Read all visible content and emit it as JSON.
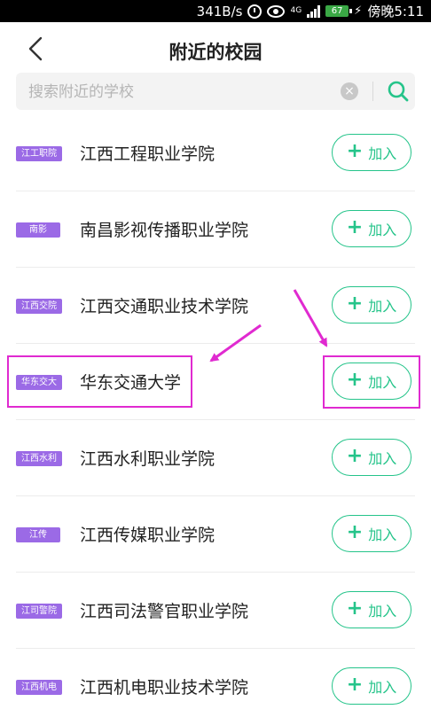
{
  "status_bar": {
    "speed": "341B/s",
    "signal": "4G",
    "battery": "67",
    "time": "傍晚5:11"
  },
  "header": {
    "title": "附近的校园"
  },
  "search": {
    "placeholder": "搜索附近的学校",
    "clear_glyph": "×"
  },
  "join_label": "加入",
  "plus_glyph": "+",
  "schools": [
    {
      "tag": "江工职院",
      "name": "江西工程职业学院"
    },
    {
      "tag": "南影",
      "name": "南昌影视传播职业学院"
    },
    {
      "tag": "江西交院",
      "name": "江西交通职业技术学院"
    },
    {
      "tag": "华东交大",
      "name": "华东交通大学"
    },
    {
      "tag": "江西水利",
      "name": "江西水利职业学院"
    },
    {
      "tag": "江传",
      "name": "江西传媒职业学院"
    },
    {
      "tag": "江司警院",
      "name": "江西司法警官职业学院"
    },
    {
      "tag": "江西机电",
      "name": "江西机电职业技术学院"
    }
  ],
  "colors": {
    "accent": "#25c48a",
    "tag": "#9b6ae6",
    "annotation": "#e02ad0"
  },
  "icons": [
    "back-arrow-icon",
    "clear-icon",
    "search-icon",
    "plus-icon",
    "alarm-icon",
    "eye-icon",
    "battery-icon"
  ]
}
